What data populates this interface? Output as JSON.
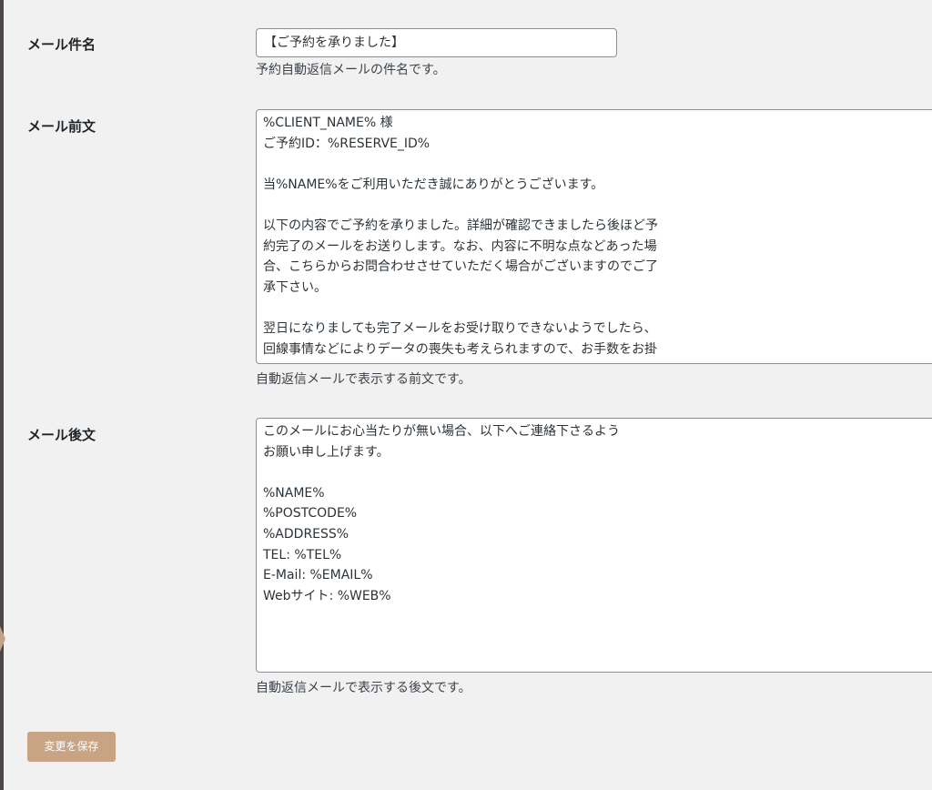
{
  "subject": {
    "label": "メール件名",
    "value": "【ご予約を承りました】",
    "description": "予約自動返信メールの件名です。"
  },
  "preface": {
    "label": "メール前文",
    "lines": [
      "%CLIENT_NAME% 様",
      "ご予約ID：%RESERVE_ID%",
      "",
      "当%NAME%をご利用いただき誠にありがとうございます。",
      "",
      "以下の内容でご予約を承りました。詳細が確認できましたら後ほど予",
      "約完了のメールをお送りします。なお、内容に不明な点などあった場",
      "合、こちらからお問合わせさせていただく場合がございますのでご了",
      "承下さい。",
      "",
      "翌日になりましても完了メールをお受け取りできないようでしたら、",
      "回線事情などによりデータの喪失も考えられますので、お手数をお掛"
    ],
    "description": "自動返信メールで表示する前文です。"
  },
  "postscript": {
    "label": "メール後文",
    "lines": [
      "このメールにお心当たりが無い場合、以下へご連絡下さるよう",
      "お願い申し上げます。",
      "",
      "%NAME%",
      "%POSTCODE%",
      "%ADDRESS%",
      "TEL: %TEL%",
      "E-Mail: %EMAIL%",
      "Webサイト: %WEB%"
    ],
    "description": "自動返信メールで表示する後文です。"
  },
  "save_button": {
    "label": "変更を保存"
  },
  "colors": {
    "accent": "#c8a484",
    "background": "#f1f1f1",
    "input_border": "#8c8f94"
  }
}
